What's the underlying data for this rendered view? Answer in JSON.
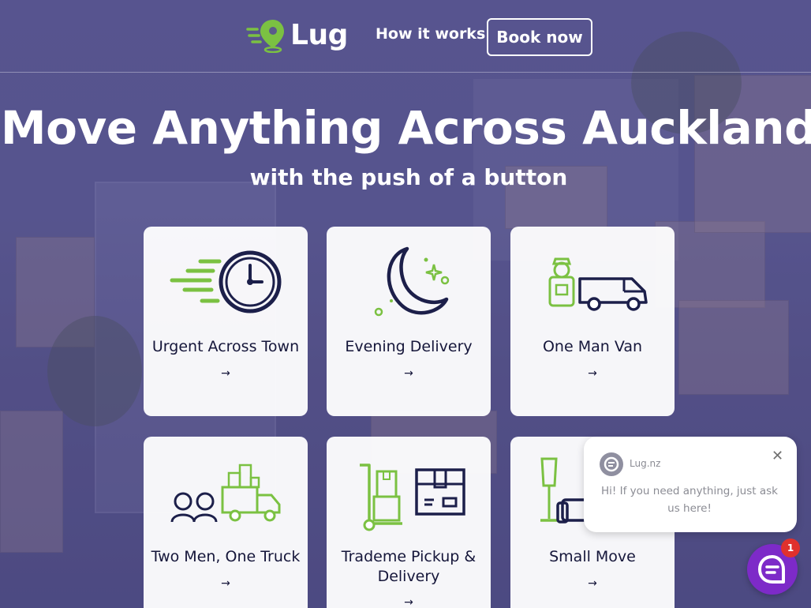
{
  "brand": {
    "name": "Lug",
    "accent": "#7bc142",
    "navy": "#1c1f4a"
  },
  "nav": {
    "how_it_works": "How it works",
    "book_now": "Book now"
  },
  "hero": {
    "title": "Move Anything Across Auckland",
    "subtitle": "with the push of a button"
  },
  "services": [
    {
      "label": "Urgent Across Town",
      "icon": "speeding-clock-icon",
      "arrow": "→"
    },
    {
      "label": "Evening Delivery",
      "icon": "moon-stars-icon",
      "arrow": "→"
    },
    {
      "label": "One Man Van",
      "icon": "mover-van-icon",
      "arrow": "→"
    },
    {
      "label": "Two Men, One Truck",
      "icon": "two-men-truck-icon",
      "arrow": "→"
    },
    {
      "label": "Trademe Pickup & Delivery",
      "icon": "hand-truck-box-icon",
      "arrow": "→"
    },
    {
      "label": "Small Move",
      "icon": "furniture-lamp-icon",
      "arrow": "→"
    }
  ],
  "chat": {
    "name": "Lug.nz",
    "message": "Hi! If you need anything, just ask us here!",
    "close": "✕",
    "badge": "1",
    "launcher_color": "#7d2ac8",
    "badge_color": "#e0312c"
  }
}
